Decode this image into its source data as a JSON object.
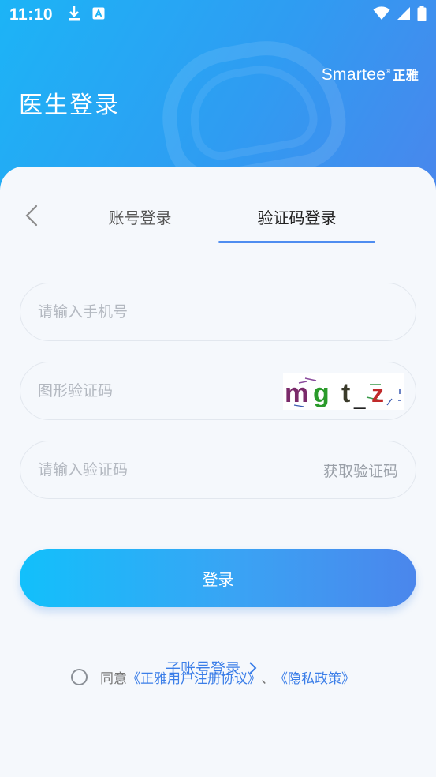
{
  "status_bar": {
    "time": "11:10",
    "left_icons": [
      "download-icon",
      "app-store-icon"
    ],
    "right_icons": [
      "wifi-icon",
      "signal-icon",
      "battery-icon"
    ]
  },
  "header": {
    "brand": "Smartee",
    "brand_mark": "®",
    "brand_cn": "正雅",
    "title": "医生登录"
  },
  "tabs": {
    "account": "账号登录",
    "code": "验证码登录",
    "active": "code"
  },
  "form": {
    "phone_placeholder": "请输入手机号",
    "captcha_placeholder": "图形验证码",
    "captcha_text": "mg t_z",
    "code_placeholder": "请输入验证码",
    "get_code": "获取验证码"
  },
  "login_button": "登录",
  "sub_account": "子账号登录",
  "agreement": {
    "prefix": "同意",
    "user_agreement": "《正雅用户注册协议》",
    "separator": "、",
    "privacy": "《隐私政策》"
  },
  "colors": {
    "accent": "#4f8df0",
    "link": "#3b7ee8",
    "gradient_start": "#12c0fb",
    "gradient_end": "#4b86ec"
  }
}
